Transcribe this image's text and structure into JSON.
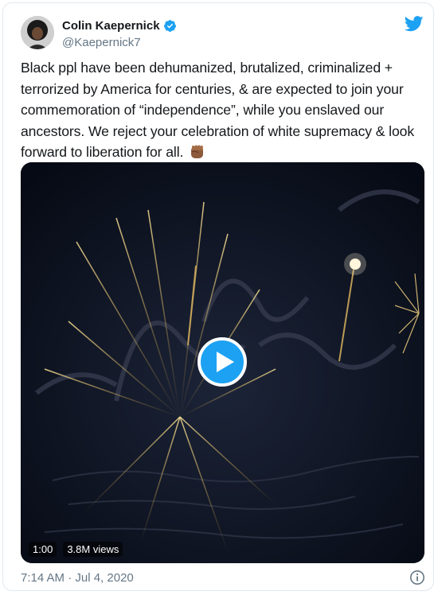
{
  "user": {
    "display_name": "Colin Kaepernick",
    "handle": "@Kaepernick7",
    "verified": true
  },
  "tweet": {
    "text": "Black ppl have been dehumanized, brutalized, criminalized + terrorized by America for centuries, & are expected to join your commemoration of “independence”, while you enslaved our ancestors. We reject your celebration of white supremacy & look forward to liberation for all.",
    "emoji": "raised-fist-medium-dark",
    "timestamp": "7:14 AM · Jul 4, 2020"
  },
  "video": {
    "duration": "1:00",
    "views": "3.8M views"
  },
  "icons": {
    "brand": "twitter-bird-icon",
    "verified": "verified-badge-icon",
    "play": "play-icon",
    "info": "info-icon"
  },
  "colors": {
    "twitter_blue": "#1da1f2",
    "text": "#14171a",
    "muted": "#657786",
    "border": "#e1e8ed"
  }
}
